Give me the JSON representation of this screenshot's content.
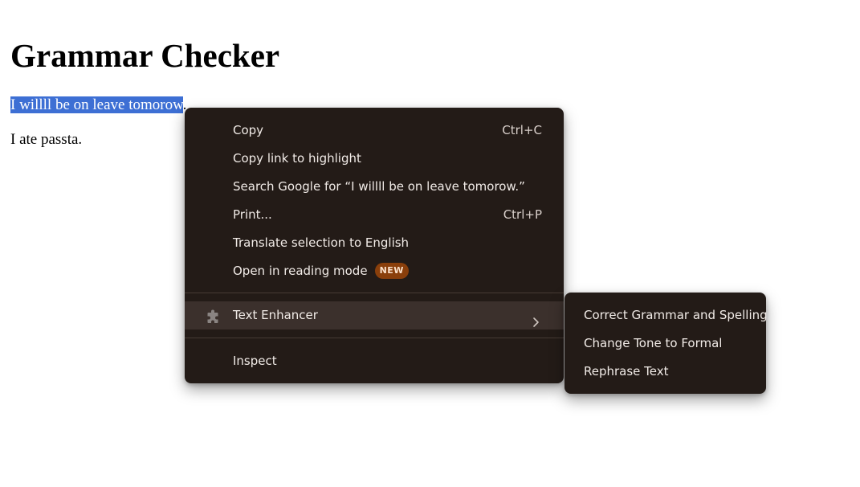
{
  "page": {
    "title": "Grammar Checker",
    "selected_text": "I willll be on leave tomorow",
    "selected_trailing": ".",
    "second_line": "I ate passta."
  },
  "context_menu": {
    "items": [
      {
        "label": "Copy",
        "shortcut": "Ctrl+C"
      },
      {
        "label": "Copy link to highlight"
      },
      {
        "label": "Search Google for “I willll be on leave tomorow.”"
      },
      {
        "label": "Print...",
        "shortcut": "Ctrl+P"
      },
      {
        "label": "Translate selection to English"
      },
      {
        "label": "Open in reading mode",
        "badge": "NEW"
      },
      {
        "label": "Text Enhancer",
        "icon": "puzzle-piece-icon",
        "has_submenu": true
      },
      {
        "label": "Inspect"
      }
    ]
  },
  "submenu": {
    "items": [
      {
        "label": "Correct Grammar and Spelling"
      },
      {
        "label": "Change Tone to Formal"
      },
      {
        "label": "Rephrase Text"
      }
    ]
  },
  "colors": {
    "menu_background": "#231b17",
    "menu_hover": "#3b302c",
    "selection": "#3d6fd4",
    "badge": "#8a3f0b"
  }
}
